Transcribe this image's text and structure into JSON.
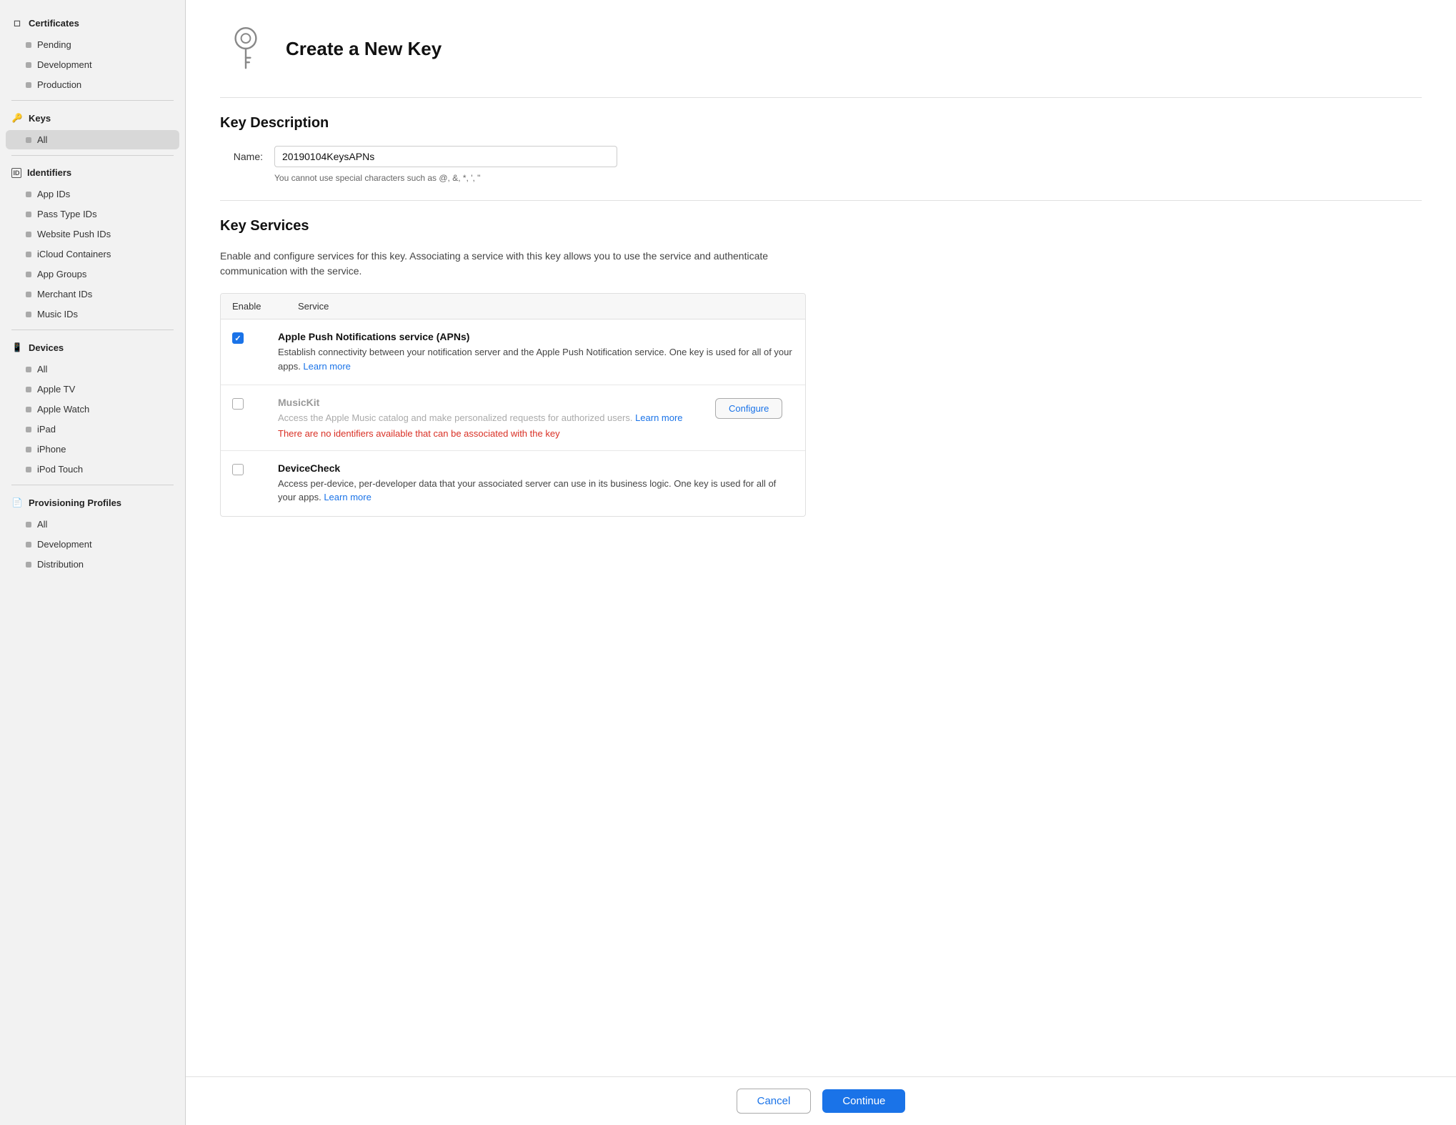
{
  "sidebar": {
    "certificates": {
      "header": "Certificates",
      "items": [
        {
          "label": "Pending",
          "active": false
        },
        {
          "label": "Development",
          "active": false
        },
        {
          "label": "Production",
          "active": false
        }
      ]
    },
    "keys": {
      "header": "Keys",
      "items": [
        {
          "label": "All",
          "active": true
        }
      ]
    },
    "identifiers": {
      "header": "Identifiers",
      "items": [
        {
          "label": "App IDs",
          "active": false
        },
        {
          "label": "Pass Type IDs",
          "active": false
        },
        {
          "label": "Website Push IDs",
          "active": false
        },
        {
          "label": "iCloud Containers",
          "active": false
        },
        {
          "label": "App Groups",
          "active": false
        },
        {
          "label": "Merchant IDs",
          "active": false
        },
        {
          "label": "Music IDs",
          "active": false
        }
      ]
    },
    "devices": {
      "header": "Devices",
      "items": [
        {
          "label": "All",
          "active": false
        },
        {
          "label": "Apple TV",
          "active": false
        },
        {
          "label": "Apple Watch",
          "active": false
        },
        {
          "label": "iPad",
          "active": false
        },
        {
          "label": "iPhone",
          "active": false
        },
        {
          "label": "iPod Touch",
          "active": false
        }
      ]
    },
    "provisioning": {
      "header": "Provisioning Profiles",
      "items": [
        {
          "label": "All",
          "active": false
        },
        {
          "label": "Development",
          "active": false
        },
        {
          "label": "Distribution",
          "active": false
        }
      ]
    }
  },
  "page": {
    "title": "Create a New Key",
    "key_description_heading": "Key Description",
    "name_label": "Name:",
    "name_value": "20190104KeysAPNs",
    "name_hint": "You cannot use special characters such as @, &, *, ', \"",
    "key_services_heading": "Key Services",
    "services_description": "Enable and configure services for this key. Associating a service with this key allows you to use the service and authenticate communication with the service.",
    "table_headers": {
      "enable": "Enable",
      "service": "Service"
    },
    "services": [
      {
        "id": "apns",
        "checked": true,
        "name": "Apple Push Notifications service (APNs)",
        "description": "Establish connectivity between your notification server and the Apple Push Notification service. One key is used for all of your apps.",
        "learn_more_label": "Learn more",
        "learn_more_url": "#",
        "has_error": false,
        "error_text": "",
        "has_configure": false,
        "configure_label": "",
        "disabled": false
      },
      {
        "id": "musickit",
        "checked": false,
        "name": "MusicKit",
        "description": "Access the Apple Music catalog and make personalized requests for authorized users.",
        "learn_more_label": "Learn more",
        "learn_more_url": "#",
        "has_error": true,
        "error_text": "There are no identifiers available that can be associated with the key",
        "has_configure": true,
        "configure_label": "Configure",
        "disabled": true
      },
      {
        "id": "devicecheck",
        "checked": false,
        "name": "DeviceCheck",
        "description": "Access per-device, per-developer data that your associated server can use in its business logic. One key is used for all of your apps.",
        "learn_more_label": "Learn more",
        "learn_more_url": "#",
        "has_error": false,
        "error_text": "",
        "has_configure": false,
        "configure_label": "",
        "disabled": false
      }
    ]
  },
  "footer": {
    "cancel_label": "Cancel",
    "continue_label": "Continue"
  }
}
